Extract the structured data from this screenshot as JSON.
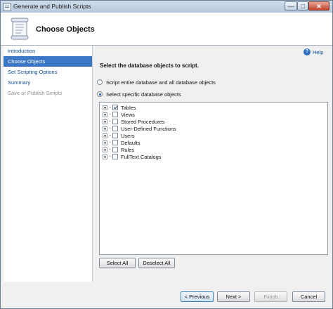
{
  "window": {
    "title": "Generate and Publish Scripts",
    "controls": {
      "minimize": "—",
      "maximize": "□",
      "close": "✕"
    }
  },
  "header": {
    "title": "Choose Objects"
  },
  "nav": {
    "items": [
      {
        "label": "Introduction",
        "state": "normal"
      },
      {
        "label": "Choose Objects",
        "state": "selected"
      },
      {
        "label": "Set Scripting Options",
        "state": "normal"
      },
      {
        "label": "Summary",
        "state": "normal"
      },
      {
        "label": "Save or Publish Scripts",
        "state": "disabled"
      }
    ]
  },
  "help": {
    "label": "Help",
    "icon": "help-icon"
  },
  "content": {
    "instruction": "Select the database objects to script.",
    "options": [
      {
        "label": "Script entire database and all database objects",
        "checked": false
      },
      {
        "label": "Select specific database objects",
        "checked": true
      }
    ],
    "tree": [
      {
        "label": "Tables",
        "checked": true
      },
      {
        "label": "Views",
        "checked": false
      },
      {
        "label": "Stored Procedures",
        "checked": false
      },
      {
        "label": "User-Defined Functions",
        "checked": false
      },
      {
        "label": "Users",
        "checked": false
      },
      {
        "label": "Defaults",
        "checked": false
      },
      {
        "label": "Rules",
        "checked": false
      },
      {
        "label": "FullText Catalogs",
        "checked": false
      }
    ],
    "select_all": "Select All",
    "deselect_all": "Deselect All"
  },
  "footer": {
    "previous": "< Previous",
    "next": "Next >",
    "finish": "Finish",
    "cancel": "Cancel"
  }
}
